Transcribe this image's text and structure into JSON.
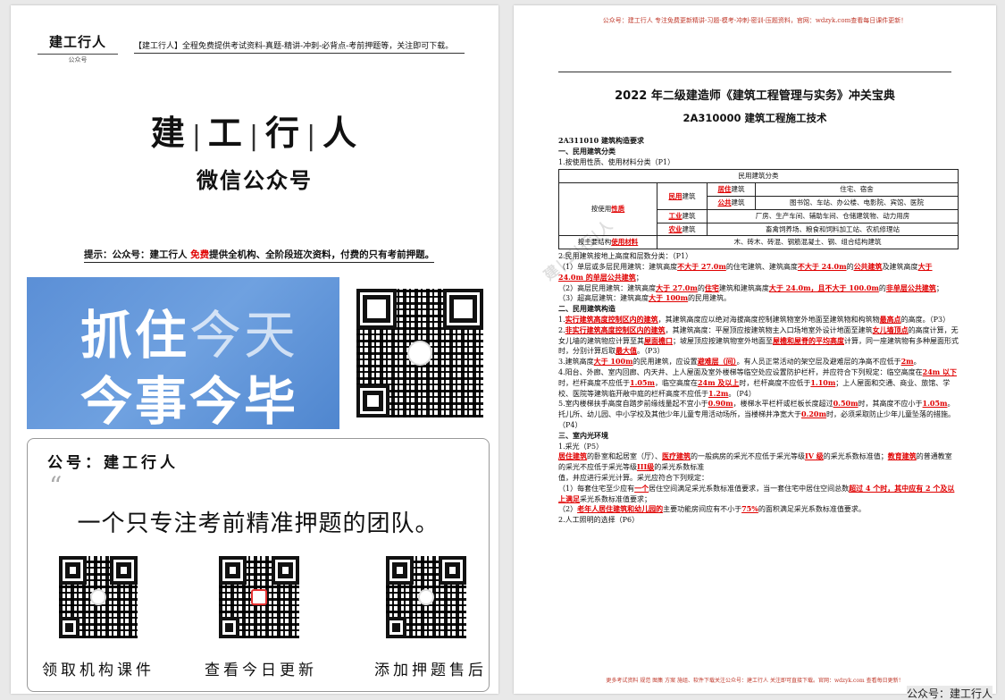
{
  "left": {
    "logo": "建工行人",
    "logo_sub": "公众号",
    "header_text": "【建工行人】全程免费提供考试资料-真题-精讲-冲刺-必背点-考前押题等，关注即可下载。",
    "big_title": [
      "建",
      "工",
      "行",
      "人"
    ],
    "big_title_sep": "|",
    "wechat_title": "微信公众号",
    "hint_prefix": "提示：公众号：建工行人 ",
    "hint_red": "免费",
    "hint_suffix": "提供全机构、全阶段班次资料，付费的只有考前押题。",
    "banner_line1_bold": "抓住",
    "banner_line1_light": "今天",
    "banner_line2_bold": "今事今毕",
    "card_account": "公号：建工行人",
    "card_quote": "“",
    "card_slogan": "一个只专注考前精准押题的团队。",
    "qr_labels": [
      "领取机构课件",
      "查看今日更新",
      "添加押题售后"
    ]
  },
  "right": {
    "header": "公众号：建工行人 专注免费更新精讲-习题-模考-冲刺-密训-压题资料，官网：wdzyk.com查看每日课件更新！",
    "title": "2022 年二级建造师《建筑工程管理与实务》冲关宝典",
    "subtitle": "2A310000 建筑工程施工技术",
    "sec_code": "2A311010 建筑构造要求",
    "s1": "一、民用建筑分类",
    "s1_p1": "1.按使用性质、使用材料分类（P1）",
    "table": {
      "caption": "民用建筑分类",
      "by_use_pre": "按使用",
      "by_use_hl": "性质",
      "civil_hl": "民用",
      "civil": "建筑",
      "res_hl": "居住",
      "res": "建筑",
      "res_desc": "住宅、宿舍",
      "pub_hl": "公共",
      "pub": "建筑",
      "pub_desc": "图书馆、车站、办公楼、电影院、宾馆、医院",
      "ind_hl": "工业",
      "ind": "建筑",
      "ind_desc": "厂房、生产车间、辅助车间、仓储建筑物、动力用房",
      "agr_hl": "农业",
      "agr": "建筑",
      "agr_desc": "畜禽饲养场、粮食和饲料加工站、农机修理站",
      "mat_pre": "按主要结构",
      "mat_hl": "使用材料",
      "mat_desc": "木、砖木、砖混、钢筋混凝土、钢、组合结构建筑"
    },
    "s1_p2": "2.民用建筑按地上高度和层数分类：（P1）",
    "h1_a": "（1）单层或多层民用建筑：建筑高度",
    "h1_b": "不大于 27.0m",
    "h1_c": "的住宅建筑、建筑高度",
    "h1_d": "不大于 24.0m",
    "h1_e": "的",
    "h1_f": "公共建筑",
    "h1_g": "及建筑高度",
    "h1_h": "大于 24.0m 的单层公共建筑",
    "h1_i": "；",
    "h2_a": "（2）高层民用建筑：建筑高度",
    "h2_b": "大于 27.0m",
    "h2_c": "的",
    "h2_d": "住宅",
    "h2_e": "建筑和建筑高度",
    "h2_f": "大于 24.0m，且不大于 100.0m",
    "h2_g": "的",
    "h2_h": "非单层公共建筑",
    "h2_i": "；",
    "h3_a": "（3）超高层建筑：建筑高度",
    "h3_b": "大于 100m",
    "h3_c": "的民用建筑。",
    "s2": "二、民用建筑构造",
    "c1_a": "1.",
    "c1_b": "实行建筑高度控制区内的建筑",
    "c1_c": "，其建筑高度应以绝对海拔高度控制建筑物室外地面至建筑物和构筑物",
    "c1_d": "最高点",
    "c1_e": "的高度。（P3）",
    "c2_a": "2.",
    "c2_b": "非实行建筑高度控制区内的建筑",
    "c2_c": "，其建筑高度：平屋顶应按建筑物主入口场地室外设计地面至建筑",
    "c2_d": "女儿墙顶点",
    "c2_e": "的高度计算，无女儿墙的建筑物应计算至其",
    "c2_f": "屋面檐口",
    "c2_g": "；坡屋顶应按建筑物室外地面至",
    "c2_h": "屋檐和屋脊的平均高度",
    "c2_i": "计算，同一座建筑物有多种屋面形式时，分别计算后取",
    "c2_j": "最大值",
    "c2_k": "。（P3）",
    "c3_a": "3.建筑高度",
    "c3_b": "大于 100m",
    "c3_c": "的民用建筑，应设置",
    "c3_d": "避难层（间）",
    "c3_e": "。有人员正常活动的架空层及避难层的净高不应低于",
    "c3_f": "2m",
    "c3_g": "。",
    "c4_a": "4.阳台、外廊、室内回廊、内天井、上人屋面及室外楼梯等临空处应设置防护栏杆，并应符合下列规定：临空高度在",
    "c4_b": "24m 以下",
    "c4_c": "时，栏杆高度不应低于",
    "c4_d": "1.05m",
    "c4_e": "，临空高度在",
    "c4_f": "24m 及以上",
    "c4_g": "时，栏杆高度不应低于",
    "c4_h": "1.10m",
    "c4_i": "；上人屋面和交通、商业、旅馆、学校、医院等建筑临开敞中庭的栏杆高度不应低于",
    "c4_j": "1.2m",
    "c4_k": "。（P4）",
    "c5_a": "5.室内楼梯扶手高度自踏步前缘线量起不宜小于",
    "c5_b": "0.90m",
    "c5_c": "，楼梯水平栏杆或栏板长度超过",
    "c5_d": "0.50m",
    "c5_e": "时，其高度不应小于",
    "c5_f": "1.05m",
    "c5_g": "。托儿所、幼儿园、中小学校及其他少年儿童专用活动场所，当楼梯井净宽大于",
    "c5_h": "0.20m",
    "c5_i": "时，必须采取防止少年儿童坠落的措施。（P4）",
    "s3": "三、室内光环境",
    "l1": "1.采光（P5）",
    "l2_a": "居住建筑",
    "l2_b": "的卧室和起居室（厅）、",
    "l2_c": "医疗建筑",
    "l2_d": "的一般病房的采光不应低于采光等级",
    "l2_e": "IV 级",
    "l2_f": "的采光系数标准值；",
    "l2_g": "教育建筑",
    "l2_h": "的普通教室的采光不应低于采光等级",
    "l2_i": "III级",
    "l2_j": "的采光系数标准",
    "l3": "值，并应进行采光计算。采光应符合下列规定：",
    "l4_a": "（1）每套住宅至少应有",
    "l4_b": "一个",
    "l4_c": "居住空间满足采光系数标准值要求，当一套住宅中居住空间总数",
    "l4_d": "超过 4 个时，其中应有 2 个及以上满足",
    "l4_e": "采光系数标准值要求；",
    "l5_a": "（2）",
    "l5_b": "老年人居住建筑和幼儿园的",
    "l5_c": "主要功能房间应有不小于",
    "l5_d": "75%",
    "l5_e": "的面积满足采光系数标准值要求。",
    "l6": "2.人工照明的选择（P6）",
    "watermark": "建|工|行|人",
    "footer": "更多考试资料 规范 图集 方案 施组、软件下载关注公众号：建工行人 关注即可直接下载。官网：wdzyk.com 查看每日更新！"
  },
  "corner_mark": "公众号：建工行人"
}
